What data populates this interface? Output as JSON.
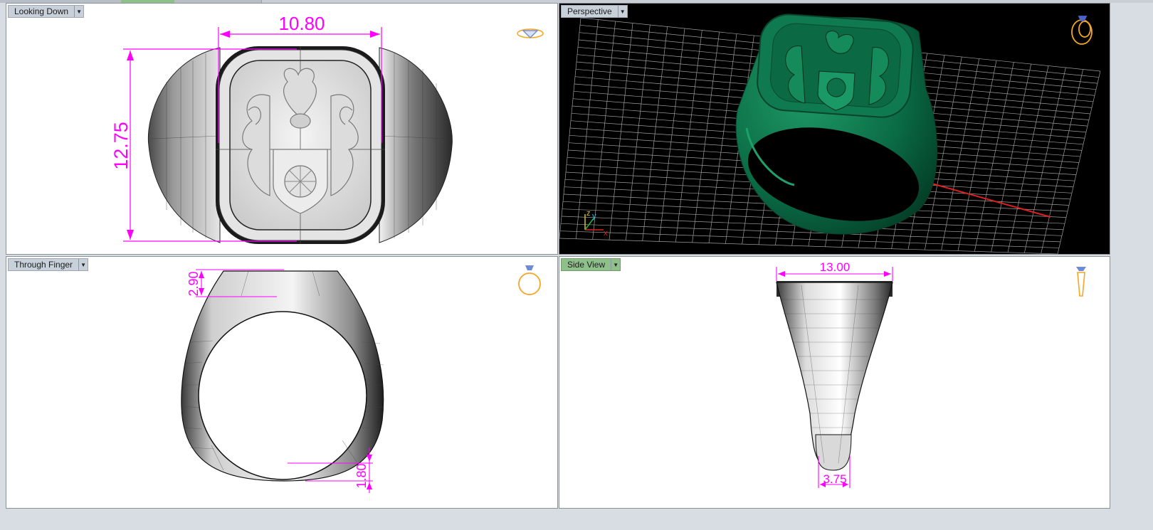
{
  "colors": {
    "dimension": "#ff00ff",
    "metal_green": "#0a6b45",
    "label_active": "#8fc08b",
    "label_inactive": "#c8d0da"
  },
  "viewports": {
    "top_left": {
      "label": "Looking Down",
      "dim_width": "10.80",
      "dim_height": "12.75"
    },
    "top_right": {
      "label": "Perspective",
      "axis_z": "z",
      "axis_y": "y",
      "axis_x": "x"
    },
    "bottom_left": {
      "label": "Through Finger",
      "dim_top": "2.90",
      "dim_bottom": "1.80"
    },
    "bottom_right": {
      "label": "Side View",
      "dim_top": "13.00",
      "dim_bottom": "3.75"
    }
  },
  "icons": {
    "top_left": "diamond-ring-icon",
    "top_right": "ring-perspective-icon",
    "bottom_left": "ring-front-icon",
    "bottom_right": "ring-side-icon"
  }
}
